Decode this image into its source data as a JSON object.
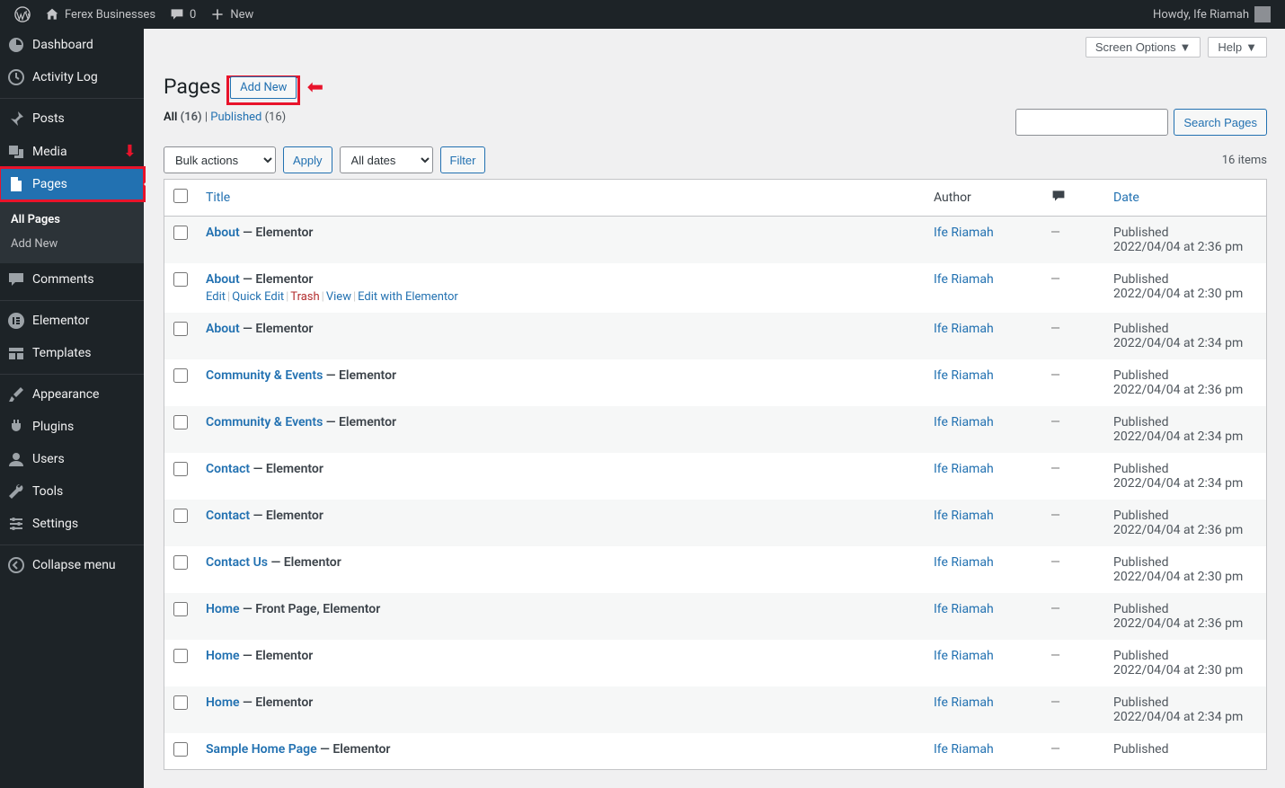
{
  "adminbar": {
    "site_name": "Ferex Businesses",
    "comments_count": "0",
    "new_label": "New",
    "howdy_prefix": "Howdy, ",
    "user_name": "Ife Riamah"
  },
  "sidebar": {
    "items": [
      {
        "id": "dashboard",
        "label": "Dashboard"
      },
      {
        "id": "activity",
        "label": "Activity Log"
      },
      {
        "id": "posts",
        "label": "Posts"
      },
      {
        "id": "media",
        "label": "Media"
      },
      {
        "id": "pages",
        "label": "Pages"
      },
      {
        "id": "comments",
        "label": "Comments"
      },
      {
        "id": "elementor",
        "label": "Elementor"
      },
      {
        "id": "templates",
        "label": "Templates"
      },
      {
        "id": "appearance",
        "label": "Appearance"
      },
      {
        "id": "plugins",
        "label": "Plugins"
      },
      {
        "id": "users",
        "label": "Users"
      },
      {
        "id": "tools",
        "label": "Tools"
      },
      {
        "id": "settings",
        "label": "Settings"
      },
      {
        "id": "collapse",
        "label": "Collapse menu"
      }
    ],
    "pages_sub": {
      "all": "All Pages",
      "add": "Add New"
    }
  },
  "header": {
    "screen_options": "Screen Options",
    "help": "Help",
    "page_title": "Pages",
    "add_new": "Add New"
  },
  "filter": {
    "all_label": "All",
    "all_count": "(16)",
    "published_label": "Published",
    "published_count": "(16)",
    "search_button": "Search Pages",
    "bulk_actions": "Bulk actions",
    "apply": "Apply",
    "all_dates": "All dates",
    "filter_btn": "Filter",
    "item_count": "16 items"
  },
  "table": {
    "headers": {
      "title": "Title",
      "author": "Author",
      "date": "Date"
    },
    "row_actions": {
      "edit": "Edit",
      "quick_edit": "Quick Edit",
      "trash": "Trash",
      "view": "View",
      "edit_elementor": "Edit with Elementor"
    },
    "rows": [
      {
        "title": "About",
        "state": "Elementor",
        "author": "Ife Riamah",
        "status": "Published",
        "date": "2022/04/04 at 2:36 pm",
        "row_actions": false
      },
      {
        "title": "About",
        "state": "Elementor",
        "author": "Ife Riamah",
        "status": "Published",
        "date": "2022/04/04 at 2:30 pm",
        "row_actions": true
      },
      {
        "title": "About",
        "state": "Elementor",
        "author": "Ife Riamah",
        "status": "Published",
        "date": "2022/04/04 at 2:34 pm",
        "row_actions": false
      },
      {
        "title": "Community & Events",
        "state": "Elementor",
        "author": "Ife Riamah",
        "status": "Published",
        "date": "2022/04/04 at 2:36 pm",
        "row_actions": false
      },
      {
        "title": "Community & Events",
        "state": "Elementor",
        "author": "Ife Riamah",
        "status": "Published",
        "date": "2022/04/04 at 2:34 pm",
        "row_actions": false
      },
      {
        "title": "Contact",
        "state": "Elementor",
        "author": "Ife Riamah",
        "status": "Published",
        "date": "2022/04/04 at 2:34 pm",
        "row_actions": false
      },
      {
        "title": "Contact",
        "state": "Elementor",
        "author": "Ife Riamah",
        "status": "Published",
        "date": "2022/04/04 at 2:36 pm",
        "row_actions": false
      },
      {
        "title": "Contact Us",
        "state": "Elementor",
        "author": "Ife Riamah",
        "status": "Published",
        "date": "2022/04/04 at 2:30 pm",
        "row_actions": false
      },
      {
        "title": "Home",
        "state": "Front Page, Elementor",
        "author": "Ife Riamah",
        "status": "Published",
        "date": "2022/04/04 at 2:36 pm",
        "row_actions": false
      },
      {
        "title": "Home",
        "state": "Elementor",
        "author": "Ife Riamah",
        "status": "Published",
        "date": "2022/04/04 at 2:30 pm",
        "row_actions": false
      },
      {
        "title": "Home",
        "state": "Elementor",
        "author": "Ife Riamah",
        "status": "Published",
        "date": "2022/04/04 at 2:34 pm",
        "row_actions": false
      },
      {
        "title": "Sample Home Page",
        "state": "Elementor",
        "author": "Ife Riamah",
        "status": "Published",
        "date": "",
        "row_actions": false
      }
    ]
  }
}
